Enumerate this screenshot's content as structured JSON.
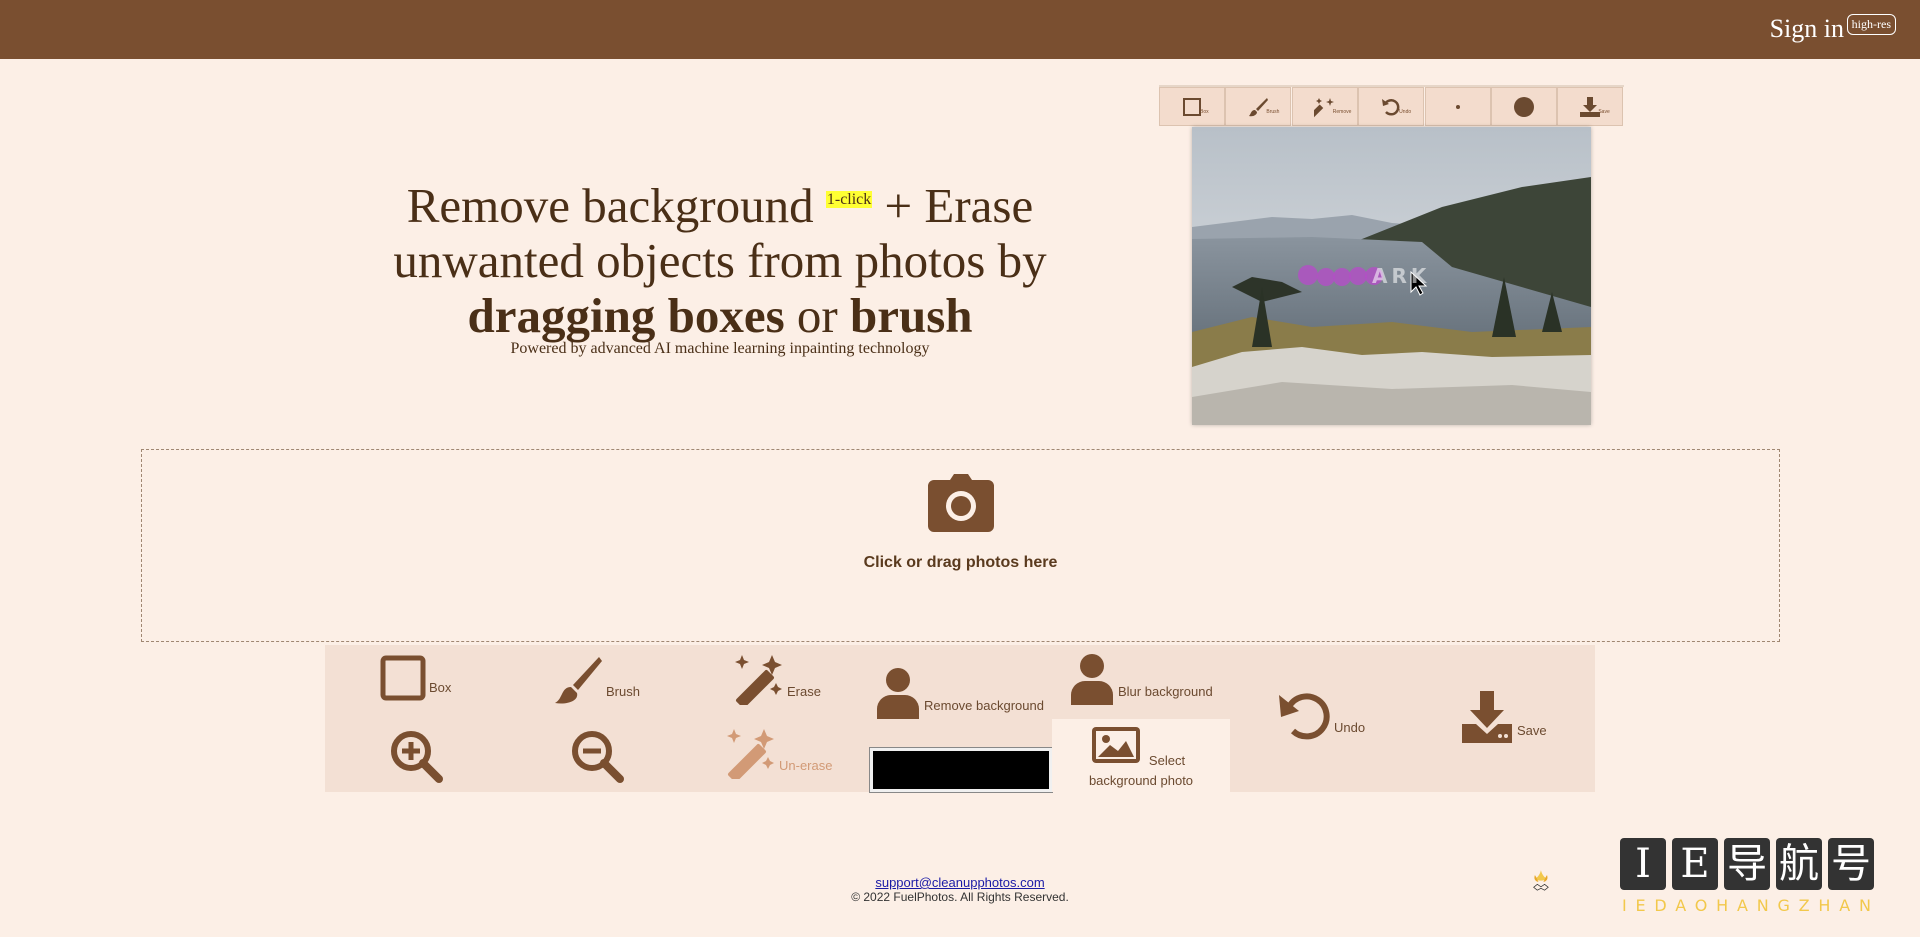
{
  "header": {
    "signin_label": "Sign in",
    "badge": "high-res"
  },
  "hero": {
    "line1_a": "Remove background ",
    "highlight": "1-click",
    "line1_b": " + Erase",
    "line2": "unwanted objects from photos by",
    "line3_bold1": "dragging boxes",
    "line3_mid": " or ",
    "line3_bold2": "brush",
    "subtitle": "Powered by advanced AI machine learning inpainting technology"
  },
  "demo": {
    "toolbar": [
      {
        "name": "box",
        "label": "Box"
      },
      {
        "name": "brush",
        "label": "Brush"
      },
      {
        "name": "erase",
        "label": "Remove"
      },
      {
        "name": "undo",
        "label": "Undo"
      },
      {
        "name": "small-brush",
        "label": ""
      },
      {
        "name": "large-brush",
        "label": ""
      },
      {
        "name": "save",
        "label": "Save"
      }
    ],
    "watermark_text": "ARK"
  },
  "dropzone": {
    "label": "Click or drag photos here"
  },
  "tools": {
    "box": "Box",
    "brush": "Brush",
    "erase": "Erase",
    "remove_background": "Remove background",
    "blur_background": "Blur background",
    "undo": "Undo",
    "save": "Save",
    "unerase": "Un-erase",
    "select_bg_line1": "Select",
    "select_bg_line2": "background photo",
    "bg_color": "#000000"
  },
  "footer": {
    "email": "support@cleanupphotos.com",
    "copyright": "© 2022 FuelPhotos. All Rights Reserved."
  },
  "logo": {
    "chars": [
      "I",
      "E",
      "导",
      "航",
      "号"
    ],
    "sub": "IEDAOHANGZHAN"
  },
  "colors": {
    "brown": "#7a4f30",
    "bg": "#fcefe6",
    "panel": "#f3e0d4",
    "highlight": "#ffff33"
  }
}
